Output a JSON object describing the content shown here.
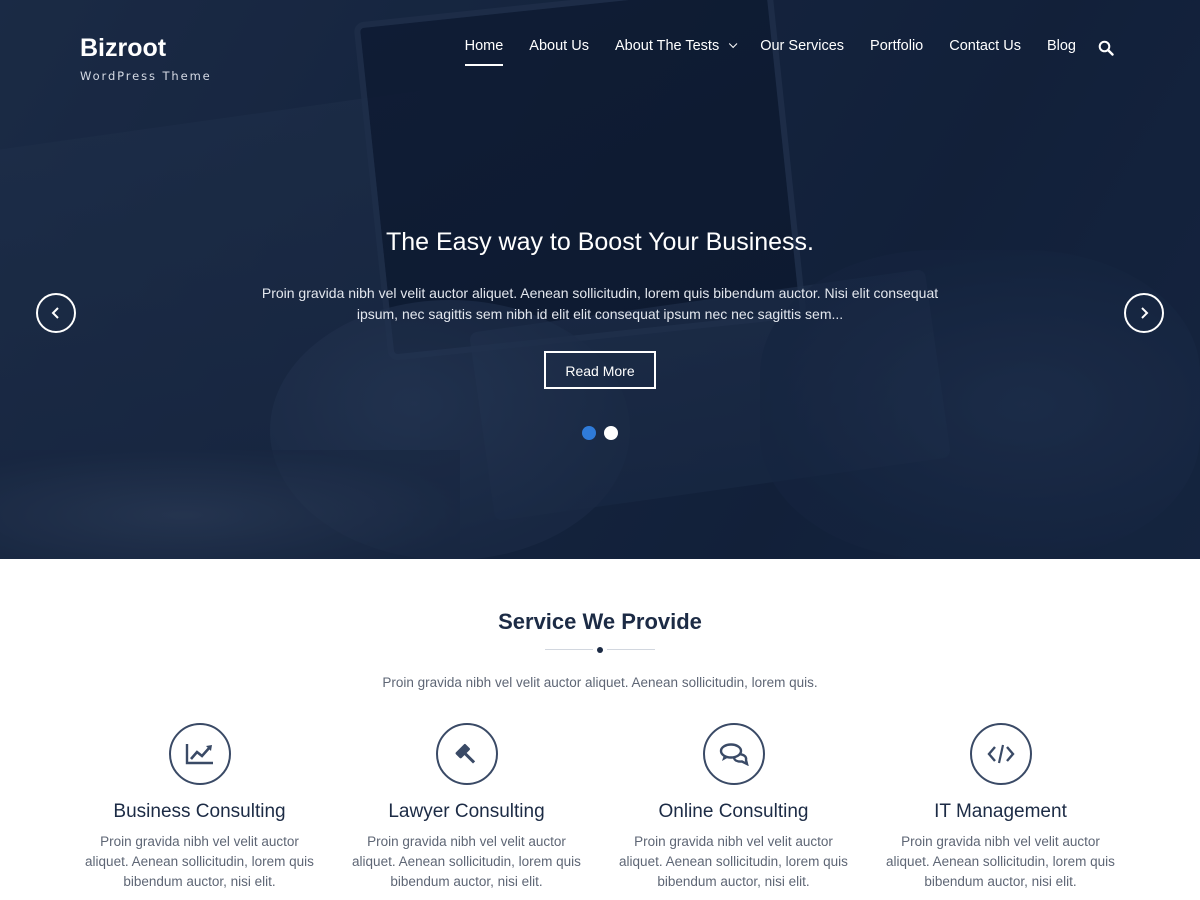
{
  "brand": {
    "title": "Bizroot",
    "tagline": "WordPress Theme"
  },
  "nav": {
    "items": [
      {
        "label": "Home",
        "active": true
      },
      {
        "label": "About Us"
      },
      {
        "label": "About The Tests",
        "has_dropdown": true
      },
      {
        "label": "Our Services"
      },
      {
        "label": "Portfolio"
      },
      {
        "label": "Contact Us"
      },
      {
        "label": "Blog"
      }
    ],
    "search_icon": "search-icon"
  },
  "slider": {
    "title": "The Easy way to Boost Your Business.",
    "text": "Proin gravida nibh vel velit auctor aliquet. Aenean sollicitudin, lorem quis bibendum auctor. Nisi elit consequat ipsum, nec sagittis sem nibh id elit elit consequat ipsum nec nec sagittis sem...",
    "button_label": "Read More",
    "prev_icon": "chevron-left-icon",
    "next_icon": "chevron-right-icon",
    "slide_count": 2,
    "active_slide": 1,
    "colors": {
      "active_dot": "#2f7bd9",
      "dot": "#ffffff"
    }
  },
  "services": {
    "title": "Service We Provide",
    "subtitle": "Proin gravida nibh vel velit auctor aliquet. Aenean sollicitudin, lorem quis.",
    "items": [
      {
        "icon": "chart-icon",
        "title": "Business Consulting",
        "text": "Proin gravida nibh vel velit auctor aliquet. Aenean sollicitudin, lorem quis bibendum auctor, nisi elit."
      },
      {
        "icon": "gavel-icon",
        "title": "Lawyer Consulting",
        "text": "Proin gravida nibh vel velit auctor aliquet. Aenean sollicitudin, lorem quis bibendum auctor, nisi elit."
      },
      {
        "icon": "comments-icon",
        "title": "Online Consulting",
        "text": "Proin gravida nibh vel velit auctor aliquet. Aenean sollicitudin, lorem quis bibendum auctor, nisi elit."
      },
      {
        "icon": "code-icon",
        "title": "IT Management",
        "text": "Proin gravida nibh vel velit auctor aliquet. Aenean sollicitudin, lorem quis bibendum auctor, nisi elit."
      }
    ]
  },
  "colors": {
    "hero_overlay": "#14223a",
    "heading": "#1c2b45",
    "body_text": "#5e6675",
    "accent": "#2f7bd9"
  }
}
